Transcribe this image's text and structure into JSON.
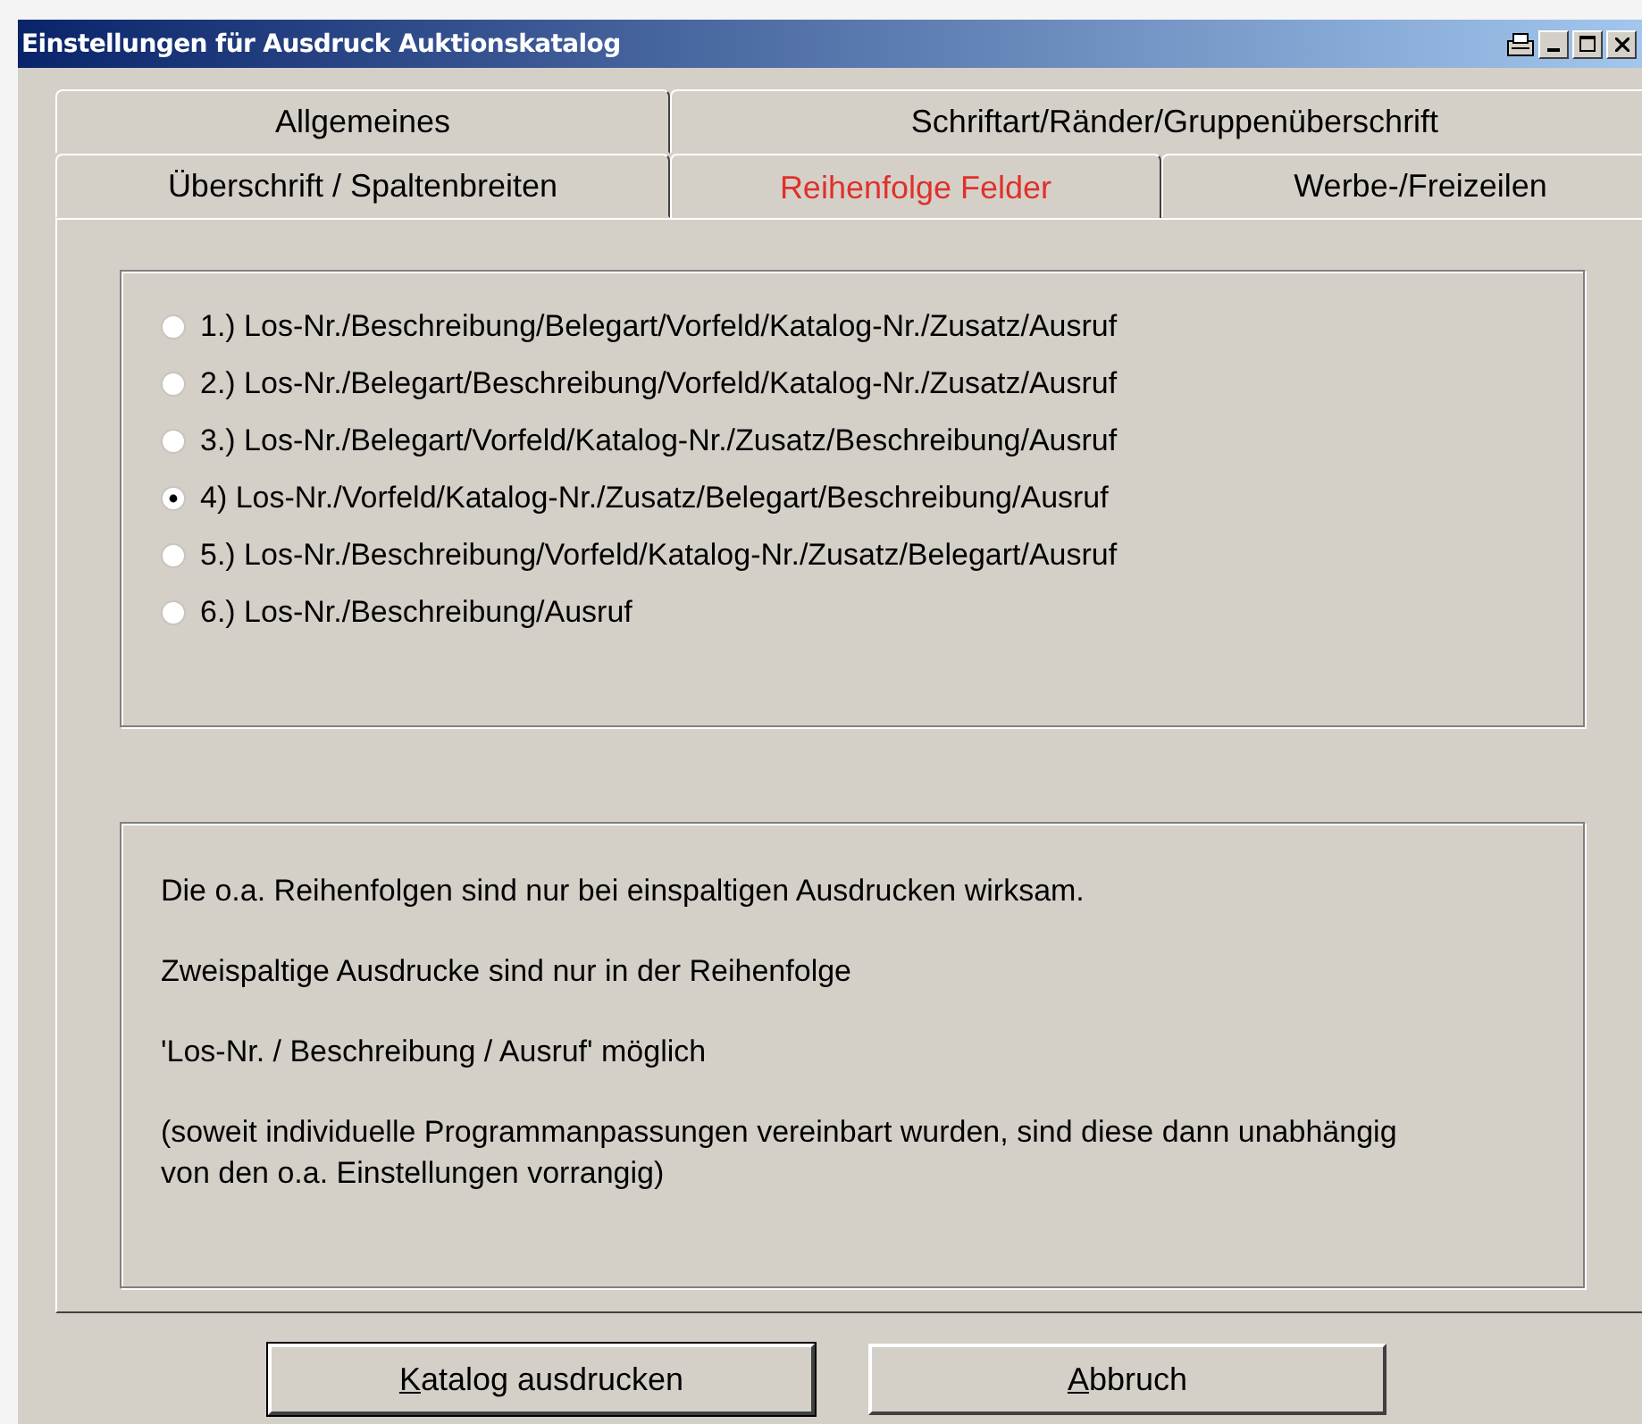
{
  "window": {
    "title": "Einstellungen für Ausdruck Auktionskatalog"
  },
  "tab_rows": [
    [
      {
        "label": "Allgemeines",
        "selected": false
      },
      {
        "label": "Schriftart/Ränder/Gruppenüberschrift",
        "selected": false
      }
    ],
    [
      {
        "label": "Überschrift / Spaltenbreiten",
        "selected": false
      },
      {
        "label": "Reihenfolge Felder",
        "selected": true
      },
      {
        "label": "Werbe-/Freizeilen",
        "selected": false
      }
    ]
  ],
  "order_options": [
    {
      "label": "1.) Los-Nr./Beschreibung/Belegart/Vorfeld/Katalog-Nr./Zusatz/Ausruf",
      "selected": false
    },
    {
      "label": "2.) Los-Nr./Belegart/Beschreibung/Vorfeld/Katalog-Nr./Zusatz/Ausruf",
      "selected": false
    },
    {
      "label": "3.) Los-Nr./Belegart/Vorfeld/Katalog-Nr./Zusatz/Beschreibung/Ausruf",
      "selected": false
    },
    {
      "label": "4) Los-Nr./Vorfeld/Katalog-Nr./Zusatz/Belegart/Beschreibung/Ausruf",
      "selected": true
    },
    {
      "label": "5.) Los-Nr./Beschreibung/Vorfeld/Katalog-Nr./Zusatz/Belegart/Ausruf",
      "selected": false
    },
    {
      "label": "6.) Los-Nr./Beschreibung/Ausruf",
      "selected": false
    }
  ],
  "notes": [
    "Die o.a. Reihenfolgen sind nur bei einspaltigen Ausdrucken wirksam.",
    "Zweispaltige Ausdrucke sind nur in der Reihenfolge",
    "'Los-Nr. / Beschreibung / Ausruf' möglich",
    "(soweit individuelle Programmanpassungen vereinbart wurden, sind diese dann unabhängig von den o.a. Einstellungen vorrangig)"
  ],
  "buttons": [
    {
      "label": "Katalog ausdrucken",
      "default": true
    },
    {
      "label": "Abbruch",
      "default": false
    }
  ]
}
